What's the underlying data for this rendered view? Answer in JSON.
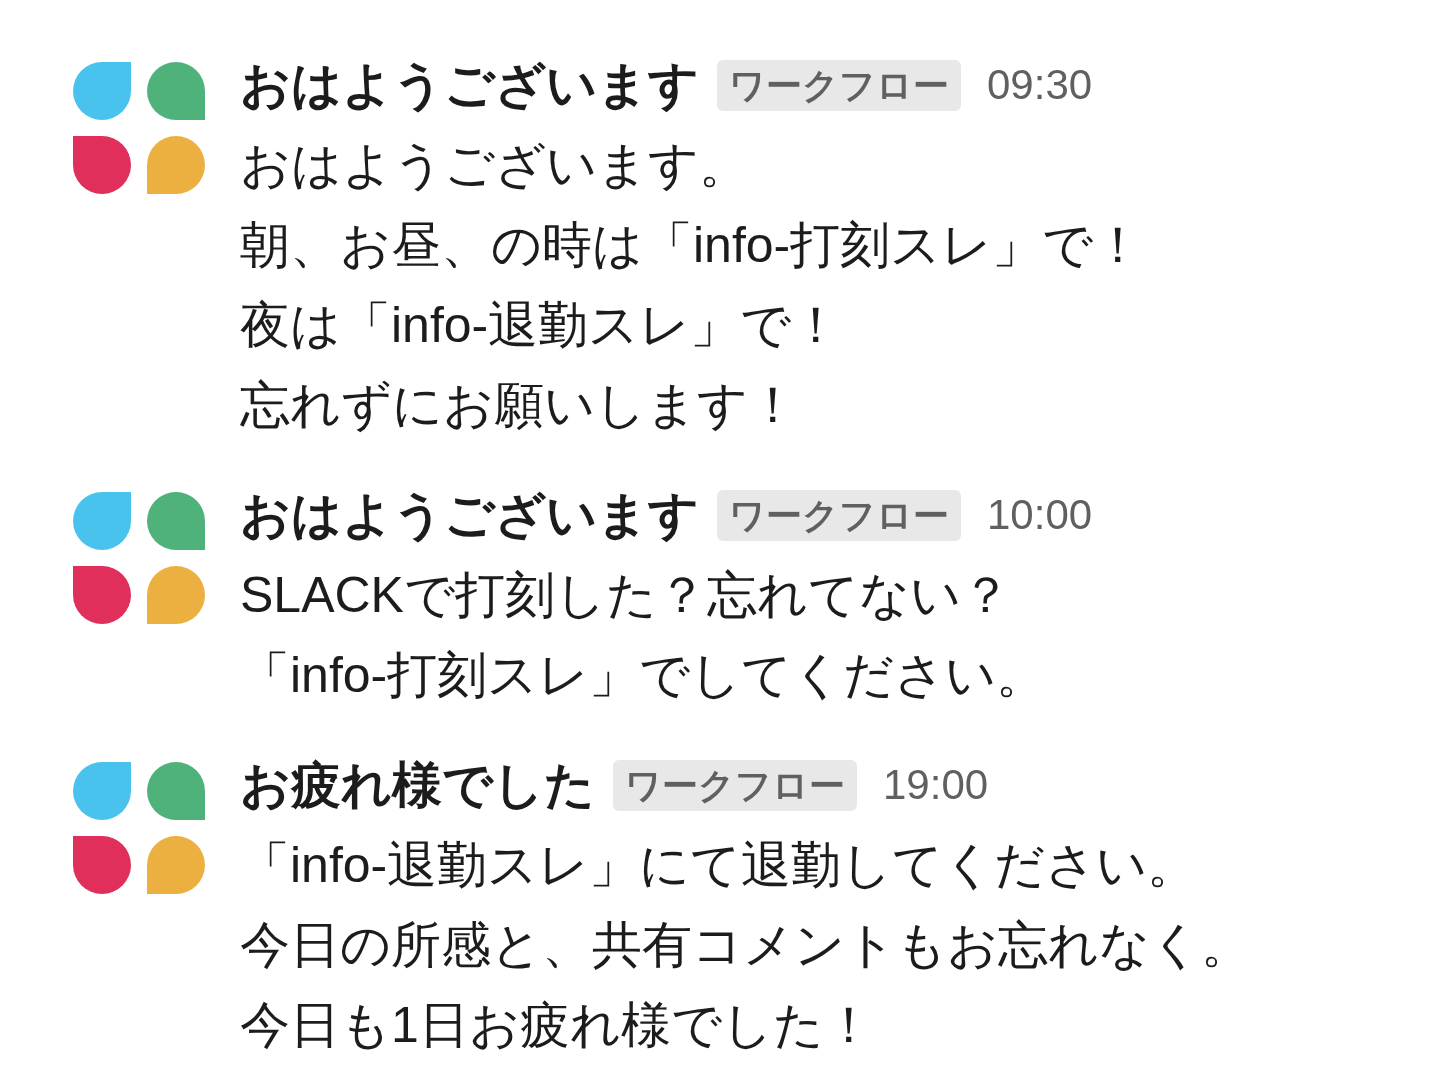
{
  "messages": [
    {
      "sender": "おはようございます",
      "badge": "ワークフロー",
      "time": "09:30",
      "lines": [
        "おはようございます。",
        "朝、お昼、の時は「info-打刻スレ」で！",
        "夜は「info-退勤スレ」で！",
        "忘れずにお願いします！"
      ]
    },
    {
      "sender": "おはようございます",
      "badge": "ワークフロー",
      "time": "10:00",
      "lines": [
        "SLACKで打刻した？忘れてない？",
        "「info-打刻スレ」でしてください。"
      ]
    },
    {
      "sender": "お疲れ様でした",
      "badge": "ワークフロー",
      "time": "19:00",
      "lines": [
        "「info-退勤スレ」にて退勤してください。",
        "今日の所感と、共有コメントもお忘れなく。",
        "今日も1日お疲れ様でした！"
      ]
    }
  ]
}
